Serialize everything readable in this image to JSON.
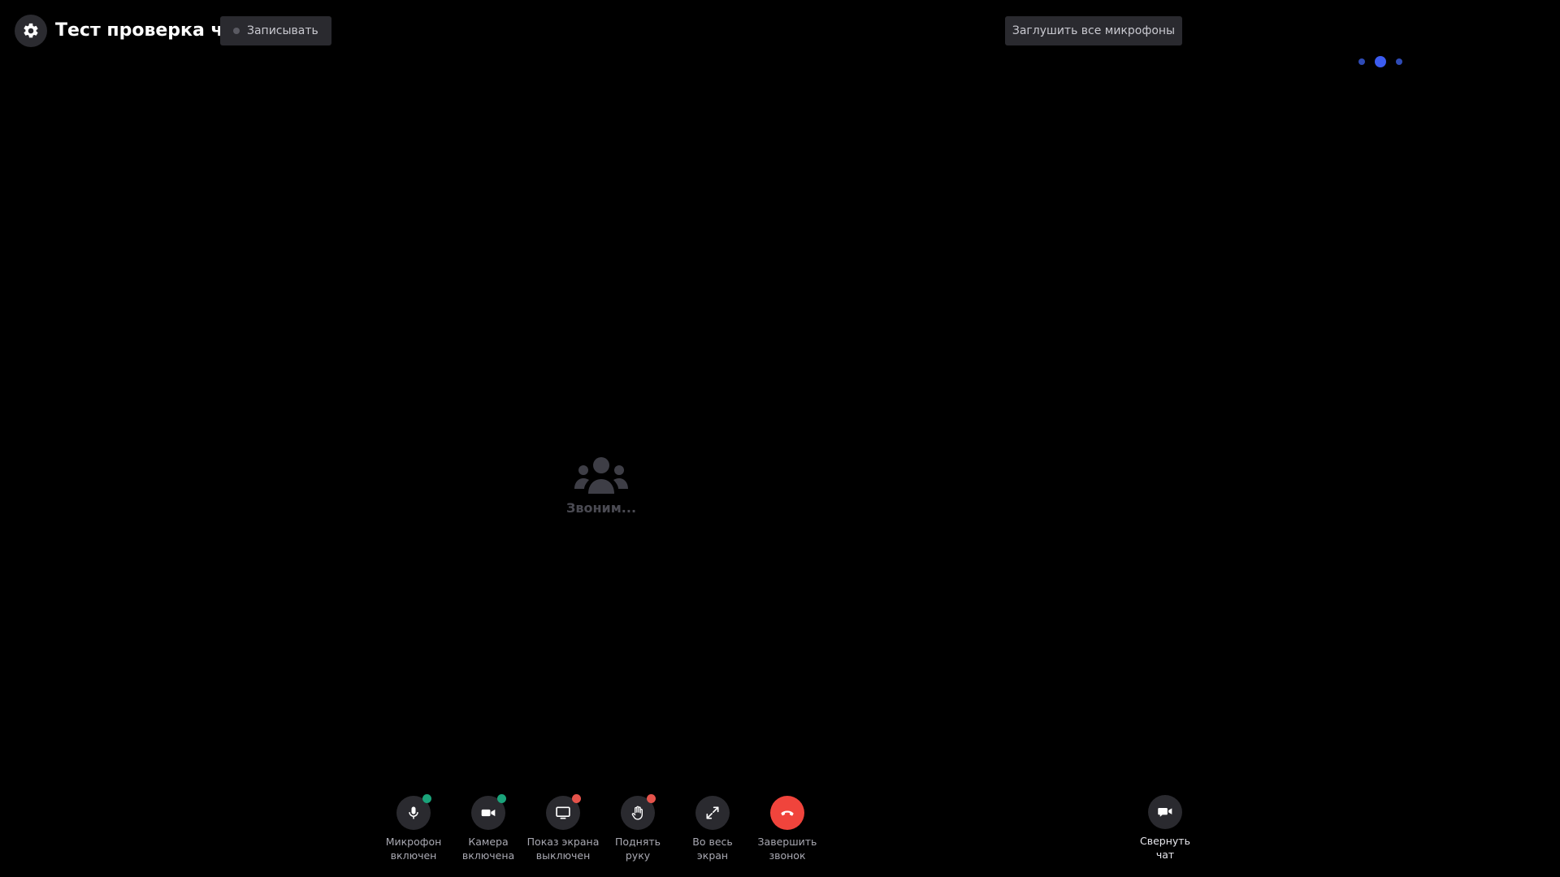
{
  "header": {
    "chat_title": "Тест проверка чат",
    "record_label": "Записывать",
    "mute_all_label": "Заглушить все микрофоны"
  },
  "pager": {
    "pages": 3,
    "active_index": 1
  },
  "center": {
    "calling_text": "Звоним...",
    "icon": "users-icon"
  },
  "controls": {
    "microphone": {
      "line1": "Микрофон",
      "line2": "включен",
      "icon": "microphone-icon",
      "status": "on"
    },
    "camera": {
      "line1": "Камера",
      "line2": "включена",
      "icon": "camera-icon",
      "status": "on"
    },
    "screen_share": {
      "line1": "Показ экрана",
      "line2": "выключен",
      "icon": "monitor-icon",
      "status": "off"
    },
    "raise_hand": {
      "line1": "Поднять",
      "line2": "руку",
      "icon": "hand-icon",
      "status": "off"
    },
    "fullscreen": {
      "line1": "Во весь",
      "line2": "экран",
      "icon": "expand-icon"
    },
    "end_call": {
      "line1": "Завершить",
      "line2": "звонок",
      "icon": "phone-hangup-icon"
    },
    "collapse_chat": {
      "line1": "Свернуть",
      "line2": "чат",
      "icon": "video-chat-icon"
    }
  },
  "colors": {
    "background": "#000000",
    "status_on": "#1aa37a",
    "status_off": "#e5534b",
    "end_call": "#f0443c",
    "pager_active": "#3c5cf0",
    "pager_inactive": "#2f4bb6"
  }
}
